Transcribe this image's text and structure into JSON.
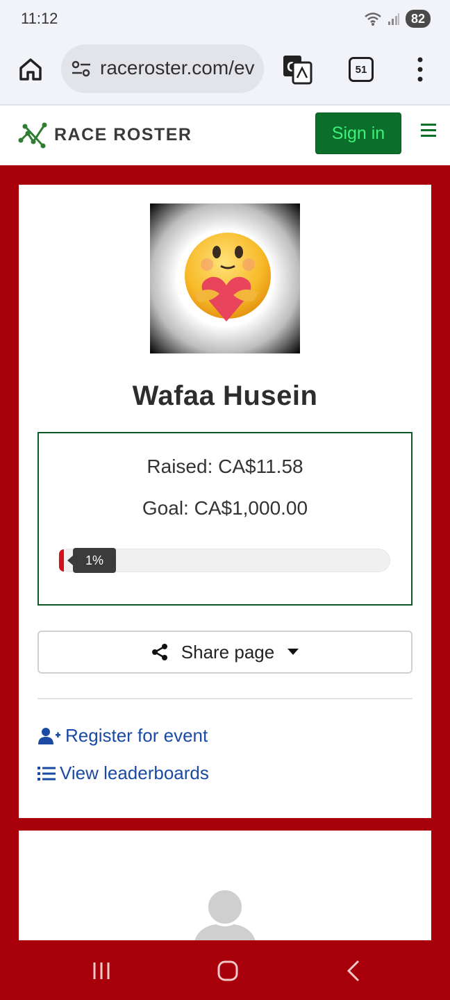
{
  "status": {
    "time": "11:12",
    "battery": "82"
  },
  "browser": {
    "url": "raceroster.com/ev",
    "tab_count": "51"
  },
  "site": {
    "brand": "RACE ROSTER",
    "signin_label": "Sign in"
  },
  "profile": {
    "name": "Wafaa Husein",
    "raised": "Raised: CA$11.58",
    "goal": "Goal: CA$1,000.00",
    "progress_label": "1%",
    "progress_percent": 1
  },
  "actions": {
    "share_label": "Share page",
    "register_label": "Register for event",
    "leaderboards_label": "View leaderboards"
  },
  "colors": {
    "brand_green": "#0b6e2a",
    "page_red": "#a8000a",
    "link_blue": "#1a4aa3"
  }
}
